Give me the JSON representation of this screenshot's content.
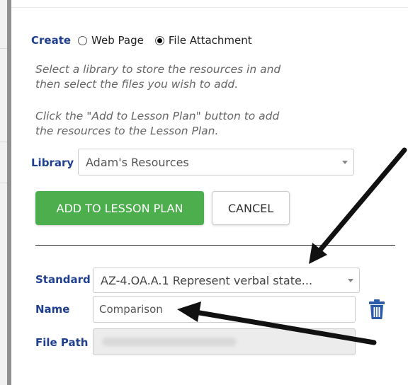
{
  "create": {
    "label": "Create",
    "options": [
      {
        "label": "Web Page",
        "selected": false
      },
      {
        "label": "File Attachment",
        "selected": true
      }
    ]
  },
  "instructions": {
    "line1": "Select a library to store the resources in and",
    "line2": "then select the files you wish to add.",
    "line3": "Click the \"Add to Lesson Plan\" button to add",
    "line4": "the resources to the Lesson Plan."
  },
  "library": {
    "label": "Library",
    "value": "Adam's Resources"
  },
  "buttons": {
    "add": "ADD TO LESSON PLAN",
    "cancel": "CANCEL"
  },
  "standard": {
    "label": "Standard",
    "value": "AZ-4.OA.A.1 Represent verbal state..."
  },
  "name": {
    "label": "Name",
    "value": "Comparison"
  },
  "file_path": {
    "label": "File Path",
    "value": ""
  },
  "colors": {
    "label_blue": "#1f3f8f",
    "add_green": "#4cae4c",
    "trash_blue": "#2a5aa8"
  },
  "icons": {
    "trash": "trash-icon",
    "arrows": "annotation-arrow"
  }
}
